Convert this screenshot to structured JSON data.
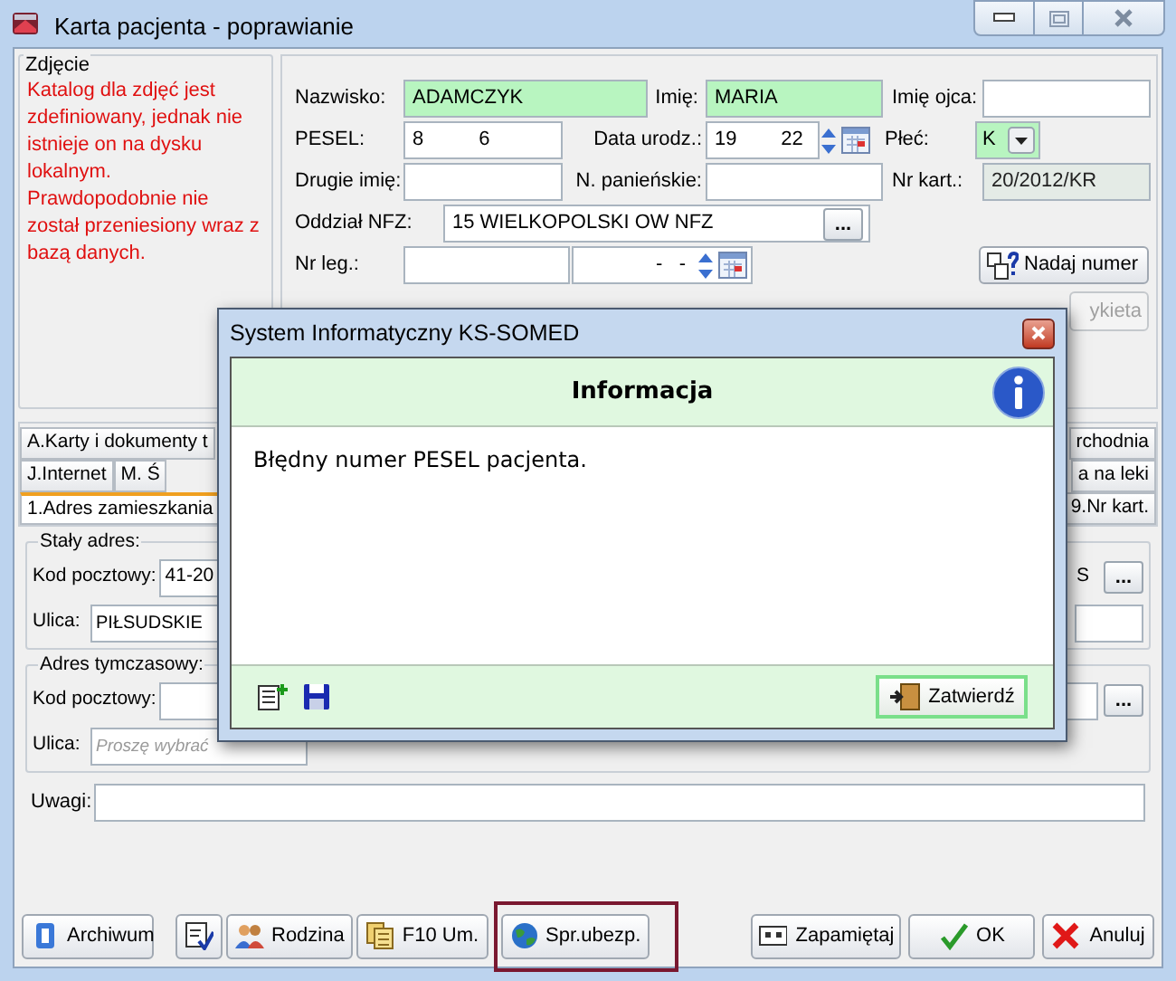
{
  "window": {
    "title": "Karta pacjenta - poprawianie"
  },
  "photo": {
    "legend": "Zdjęcie",
    "message": "Katalog dla zdjęć jest zdefiniowany, jednak nie istnieje on na dysku lokalnym. Prawdopodobnie nie został przeniesiony wraz z bazą danych."
  },
  "person": {
    "surname": {
      "label": "Nazwisko:",
      "value": "ADAMCZYK",
      "highlighted": true
    },
    "first_name": {
      "label": "Imię:",
      "value": "MARIA",
      "highlighted": true
    },
    "father_name": {
      "label": "Imię ojca:",
      "highlighted": false
    },
    "pesel": {
      "label": "PESEL:",
      "value": "8          6",
      "highlighted": false
    },
    "birth_date": {
      "label": "Data urodz.:",
      "value": "19        22",
      "highlighted": false
    },
    "sex": {
      "label": "Płeć:",
      "value": "K",
      "highlighted": true
    },
    "second_name": {
      "label": "Drugie imię:",
      "highlighted": false
    },
    "maiden_name": {
      "label": "N. panieńskie:",
      "highlighted": false
    },
    "card_number": {
      "label": "Nr kart.:",
      "value": "20/2012/KR",
      "readonly": true
    },
    "nfz": {
      "label": "Oddział NFZ:",
      "value": "15 WIELKOPOLSKI OW NFZ",
      "button": "..."
    },
    "id_card": {
      "label": "Nr leg.:",
      "date": "-   -"
    },
    "assign_button": "Nadaj numer",
    "label_button": {
      "label": "ykieta",
      "disabled": true
    }
  },
  "tabs": [
    {
      "left": [
        {
          "label": "A.Karty i dokumenty t",
          "selected": false
        }
      ],
      "right": [
        {
          "label": "rchodnia",
          "selected": false
        }
      ]
    },
    {
      "left": [
        {
          "label": "J.Internet",
          "selected": false
        },
        {
          "label": "M. Ś",
          "selected": false
        }
      ],
      "right": [
        {
          "label": "a na leki",
          "selected": false
        }
      ]
    },
    {
      "left": [
        {
          "label": "1.Adres zamieszkania",
          "selected": true
        }
      ],
      "right": [
        {
          "label": "9.Nr kart.",
          "selected": false
        }
      ]
    }
  ],
  "permanent_address": {
    "legend": "Stały adres:",
    "postal_label": "Kod pocztowy:",
    "postal_value": "41-20",
    "city_fragment": "S",
    "button": "...",
    "street_label": "Ulica:",
    "street_value": "PIŁSUDSKIE"
  },
  "temporary_address": {
    "legend": "Adres tymczasowy:",
    "postal_label": "Kod pocztowy:",
    "button": "...",
    "street_label": "Ulica:",
    "street_placeholder": "Proszę wybrać"
  },
  "notes": {
    "label": "Uwagi:"
  },
  "footer_left": [
    {
      "label": "Archiwum",
      "highlighted": false
    },
    {
      "highlighted": false
    },
    {
      "label": "Rodzina",
      "highlighted": false
    },
    {
      "label": "F10 Um.",
      "highlighted": false
    },
    {
      "label": "Spr.ubezp.",
      "highlighted": true
    }
  ],
  "footer_right": [
    {
      "label": "Zapamiętaj"
    },
    {
      "label": "OK"
    },
    {
      "label": "Anuluj"
    }
  ],
  "dialog": {
    "title": "System Informatyczny KS-SOMED",
    "heading": "Informacja",
    "message": "Błędny numer PESEL pacjenta.",
    "confirm_button": "Zatwierdź"
  }
}
